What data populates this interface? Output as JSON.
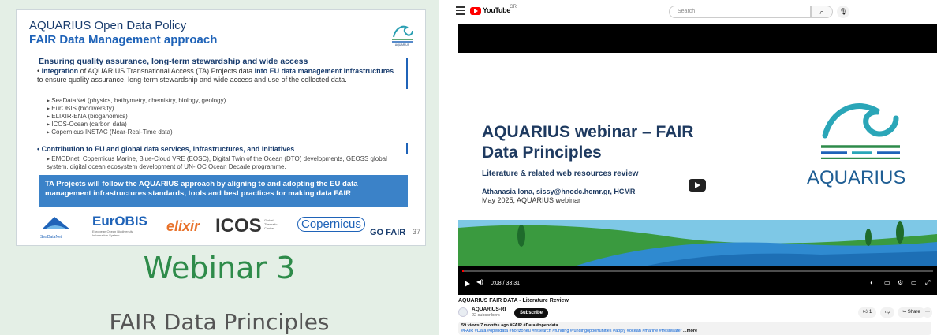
{
  "slide": {
    "title1": "AQUARIUS Open Data Policy",
    "title2": "FAIR Data Management approach",
    "heading": "Ensuring quality assurance, long-term stewardship and wide access",
    "para_lead": "Integration",
    "para_mid1": "of AQUARIUS Transnational Access (TA) Projects data",
    "para_bold": "into EU data management infrastructures",
    "para_end": "to ensure quality assurance, long-term stewardship and wide access and use of the collected data.",
    "sub_items": [
      "SeaDataNet (physics, bathymetry, chemistry, biology, geology)",
      "EurOBIS (biodiversity)",
      "ELIXIR-ENA (bioganomics)",
      "ICOS-Ocean (carbon data)",
      "Copernicus INSTAC (Near-Real-Time data)"
    ],
    "bullet2": "Contribution to EU and global data services, infrastructures, and initiatives",
    "bullet2_text": "EMODnet, Copernicus Marine, Blue-Cloud VRE (EOSC), Digital Twin of the Ocean (DTO) developments, GEOSS global system, digital ocean ecosystem development of UN-IOC Ocean Decade programme.",
    "box_text": "TA Projects will follow the AQUARIUS approach by aligning to and adopting the EU data management infrastructures standards, tools and best practices for making data FAIR",
    "logos": {
      "seadatanet": "SeaDataNet",
      "eurobis": "EurOBIS",
      "eurobis_sub": "European Ocean Biodiversity Information System",
      "elixir": "elixir",
      "icos": "ICOS",
      "icos_sub": "Global Thematic Centre",
      "copernicus": "Copernicus",
      "gofair": "GO FAIR"
    },
    "page_number": "37",
    "logo_brand": "AQUARIUS"
  },
  "left_titles": {
    "webinar": "Webinar 3",
    "subtitle": "FAIR Data Principles"
  },
  "youtube": {
    "brand": "YouTube",
    "region": "GR",
    "search_placeholder": "Search",
    "video": {
      "title_slide": "AQUARIUS webinar – FAIR Data Principles",
      "subtitle": "Literature & related web resources review",
      "author": "Athanasia Iona, sissy@hnodc.hcmr.gr, HCMR",
      "date": "May 2025, AQUARIUS webinar",
      "brand": "AQUARIUS",
      "time": "0:08 / 33:31",
      "progress_fraction": 0.004
    },
    "video_title": "AQUARIUS FAIR DATA - Literature Review",
    "channel": {
      "name": "AQUARIUS-RI",
      "subscribers": "22 subscribers",
      "subscribe_label": "Subscribe"
    },
    "actions": {
      "like_count": "1",
      "share_label": "Share",
      "more": "···"
    },
    "description": {
      "meta": "59 views  7 months ago  #FAIR #Data #opendata",
      "tags": "#FAIR #Data #opendata #horizoneu #research #funding #fundingopportunities #apply #ocean #marine #freshwater",
      "more_label": "...more"
    }
  },
  "colors": {
    "slide_blue": "#1f63b8",
    "slide_dark": "#1a3d6e",
    "webinar_green": "#2e8b4a",
    "left_bg": "#e4efe6",
    "yt_red": "#ff0000"
  }
}
